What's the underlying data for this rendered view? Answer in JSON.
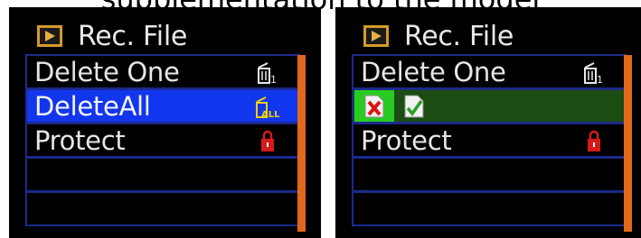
{
  "caption": "supplementation to the model",
  "colors": {
    "screen_bg": "#000000",
    "row_border": "#1b2a8c",
    "selected_blue": "#1236ee",
    "selected_green": "#1b4d12",
    "active_option": "#28cc21",
    "scrollbar": "#e06a1a",
    "lock_red": "#d61a1a",
    "all_yellow": "#f0d000"
  },
  "screens": [
    {
      "title": "Rec. File",
      "title_icon": "playback-icon",
      "items": [
        {
          "label": "Delete One",
          "icon": "trash-one-icon"
        },
        {
          "label": "DeleteAll",
          "icon": "trash-all-icon",
          "selected": true
        },
        {
          "label": "Protect",
          "icon": "lock-icon"
        },
        {
          "label": ""
        },
        {
          "label": ""
        }
      ]
    },
    {
      "title": "Rec. File",
      "title_icon": "playback-icon",
      "items": [
        {
          "label": "Delete One",
          "icon": "trash-one-icon"
        },
        {
          "label": "",
          "options": [
            "cancel-file-icon",
            "confirm-check-icon"
          ],
          "selected": true
        },
        {
          "label": "Protect",
          "icon": "lock-icon"
        },
        {
          "label": ""
        },
        {
          "label": ""
        }
      ]
    }
  ]
}
